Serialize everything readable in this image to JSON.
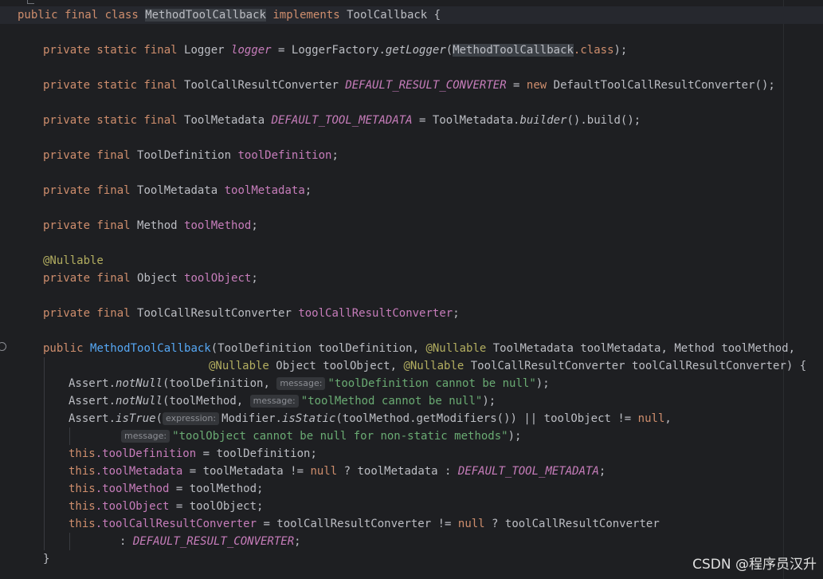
{
  "code": {
    "class_decl": {
      "public": "public",
      "final": "final",
      "class": "class",
      "name": "MethodToolCallback",
      "implements": "implements",
      "iface": "ToolCallback",
      "open": " {"
    },
    "logger": {
      "mods": "private static final",
      "type": "Logger",
      "name": "logger",
      "eq": " = LoggerFactory.",
      "method": "getLogger",
      "arg": "MethodToolCallback",
      "dotclass": ".class",
      "end": ");"
    },
    "default_converter": {
      "mods": "private static final",
      "type": "ToolCallResultConverter",
      "name": "DEFAULT_RESULT_CONVERTER",
      "eq": " = ",
      "new": "new",
      "ctor": " DefaultToolCallResultConverter();"
    },
    "default_metadata": {
      "mods": "private static final",
      "type": "ToolMetadata",
      "name": "DEFAULT_TOOL_METADATA",
      "eq": " = ToolMetadata.",
      "method": "builder",
      "end": "().build();"
    },
    "field_definition": {
      "mods": "private final",
      "type": "ToolDefinition",
      "name": "toolDefinition",
      "end": ";"
    },
    "field_metadata": {
      "mods": "private final",
      "type": "ToolMetadata",
      "name": "toolMetadata",
      "end": ";"
    },
    "field_method": {
      "mods": "private final",
      "type": "Method",
      "name": "toolMethod",
      "end": ";"
    },
    "annotation_nullable": "@Nullable",
    "field_object": {
      "mods": "private final",
      "type": "Object",
      "name": "toolObject",
      "end": ";"
    },
    "field_converter": {
      "mods": "private final",
      "type": "ToolCallResultConverter",
      "name": "toolCallResultConverter",
      "end": ";"
    },
    "ctor_line1": {
      "public": "public",
      "name": "MethodToolCallback",
      "a": "(ToolDefinition toolDefinition, ",
      "ann": "@Nullable",
      "b": " ToolMetadata toolMetadata, Method toolMethod,"
    },
    "ctor_line2": {
      "ann1": "@Nullable",
      "a": " Object toolObject, ",
      "ann2": "@Nullable",
      "b": " ToolCallResultConverter toolCallResultConverter) {"
    },
    "assert1": {
      "pre": "Assert.",
      "method": "notNull",
      "args": "(toolDefinition, ",
      "hint": "message:",
      "msg": "\"toolDefinition cannot be null\"",
      "end": ");"
    },
    "assert2": {
      "pre": "Assert.",
      "method": "notNull",
      "args": "(toolMethod, ",
      "hint": "message:",
      "msg": "\"toolMethod cannot be null\"",
      "end": ");"
    },
    "assert3": {
      "pre": "Assert.",
      "method": "isTrue",
      "open": "(",
      "hint": "expression:",
      "mod": "Modifier.",
      "static_m": "isStatic",
      "rest": "(toolMethod.getModifiers()) || toolObject != ",
      "null": "null",
      "comma": ","
    },
    "assert3_cont": {
      "hint": "message:",
      "msg": "\"toolObject cannot be null for non-static methods\"",
      "end": ");"
    },
    "assign_definition": {
      "this": "this",
      "field": ".toolDefinition",
      "rhs": " = toolDefinition;"
    },
    "assign_metadata": {
      "this": "this",
      "field": ".toolMetadata",
      "a": " = toolMetadata != ",
      "null": "null",
      "b": " ? toolMetadata : ",
      "const": "DEFAULT_TOOL_METADATA",
      "end": ";"
    },
    "assign_method": {
      "this": "this",
      "field": ".toolMethod",
      "rhs": " = toolMethod;"
    },
    "assign_object": {
      "this": "this",
      "field": ".toolObject",
      "rhs": " = toolObject;"
    },
    "assign_converter": {
      "this": "this",
      "field": ".toolCallResultConverter",
      "a": " = toolCallResultConverter != ",
      "null": "null",
      "b": " ? toolCallResultConverter"
    },
    "assign_converter_cont": {
      "colon": ": ",
      "const": "DEFAULT_RESULT_CONVERTER",
      "end": ";"
    },
    "close_brace": "}"
  },
  "watermark": "CSDN @程序员汉升"
}
